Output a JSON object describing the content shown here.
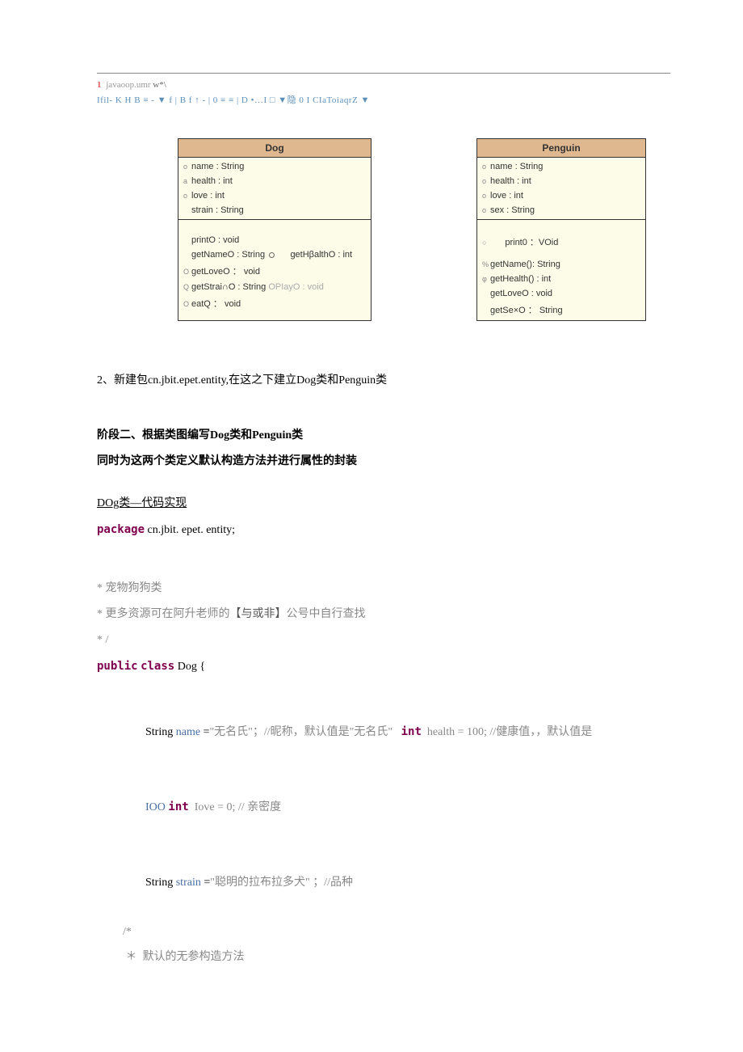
{
  "header": {
    "proj_prefix_num": "1",
    "proj_text": "javaoop.umr",
    "proj_suffix": "w*\\",
    "toolbar_raw": "Ifil- K H B ≡ - ▼ f  | B f ↑ - | 0 ≡ ≡ | D •…I  □ ▼隐 0 I CIaToiaqrZ ▼"
  },
  "uml": {
    "dog": {
      "title": "Dog",
      "attrs": [
        {
          "vis": "o",
          "text": "name : String"
        },
        {
          "vis": "a",
          "text": "health : int"
        },
        {
          "vis": "o",
          "text": "love : int"
        },
        {
          "vis": " ",
          "text": "strain : String"
        }
      ],
      "methods_col1": [
        "printO : void",
        "getNameO : String",
        "getLoveO ：  void",
        "getStrai∩O : String",
        "eatQ ：  void"
      ],
      "methods_col2": [
        "",
        "getHβalthO : int",
        "",
        "OPIayO : void",
        ""
      ],
      "vis_col1": [
        " ",
        " ",
        "O",
        "Q",
        "O"
      ]
    },
    "penguin": {
      "title": "Penguin",
      "attrs": [
        {
          "vis": "o",
          "text": "name : String"
        },
        {
          "vis": "o",
          "text": "health : int"
        },
        {
          "vis": "o",
          "text": "love : int"
        },
        {
          "vis": "o",
          "text": "sex : String"
        }
      ],
      "methods": [
        {
          "vis": "○",
          "text": "print0 ：VOid",
          "pad": true
        },
        {
          "vis": "%",
          "text": "getName(): String"
        },
        {
          "vis": "φ",
          "text": "getHealth() : int"
        },
        {
          "vis": " ",
          "text": "getLoveO : void"
        },
        {
          "vis": " ",
          "text": "getSe×O ：  String"
        }
      ]
    }
  },
  "body": {
    "line_newpkg": "2、新建包cn.jbit.epet.entity,在这之下建立Dog类和Penguin类",
    "stage2_title": "阶段二、根据类图编写Dog类和Penguin类",
    "stage2_sub": "同时为这两个类定义默认构造方法并进行属性的封装",
    "dog_impl_title": "DOg类—代码实现",
    "pkg_kw": "package",
    "pkg_val": "  cn.jbit. epet. entity;",
    "c1_pre": "*  ",
    "c1": "宠物狗狗类",
    "c2_pre": "*  ",
    "c2_a": "更多资源可在阿升老师的",
    "c2_b": "【与或非】",
    "c2_c": "公号中自行查找",
    "c3": "*  /",
    "pub": "public",
    "cls": "class",
    "cls_name": "  Dog {",
    "l1_a": "String ",
    "l1_name": "name",
    "l1_b": " =",
    "l1_str": "\"无名氏\"",
    "l1_c": "；//昵称，默认值是\"无名氏\"   ",
    "l1_int": "int",
    "l1_d": "  health = 100; //健康值，，默认值是",
    "l2_a": "IOO ",
    "l2_int": "int",
    "l2_b": "  Iove = 0; // 亲密度",
    "l3_a": "String ",
    "l3_name": "strain",
    "l3_b": " =",
    "l3_str": "\"聪明的拉布拉多犬\"",
    "l3_c": " ；//品种",
    "l4": "/*",
    "l5_a": " ＊  ",
    "l5_b": "默认的无参构造方法"
  }
}
